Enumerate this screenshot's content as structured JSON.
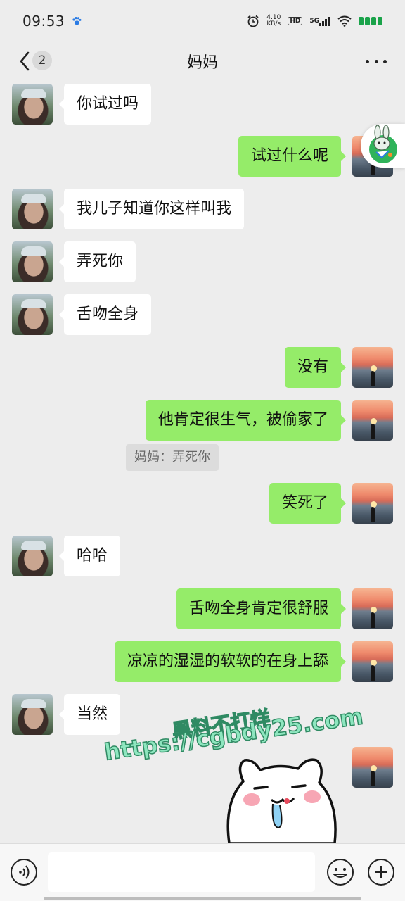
{
  "status_bar": {
    "time": "09:53",
    "net_speed_value": "4.10",
    "net_speed_unit": "KB/s",
    "hd_label": "HD",
    "signal_label": "5G",
    "battery_color": "#1aa34a"
  },
  "nav": {
    "unread_count": "2",
    "title": "妈妈"
  },
  "messages": [
    {
      "side": "in",
      "text": "你试过吗"
    },
    {
      "side": "out",
      "text": "试过什么呢"
    },
    {
      "side": "in",
      "text": "我儿子知道你这样叫我"
    },
    {
      "side": "in",
      "text": "弄死你"
    },
    {
      "side": "in",
      "text": "舌吻全身"
    },
    {
      "side": "out",
      "text": "没有"
    },
    {
      "side": "out",
      "text": "他肯定很生气，被偷家了"
    },
    {
      "side": "out",
      "text": "笑死了"
    },
    {
      "side": "in",
      "text": "哈哈"
    },
    {
      "side": "out",
      "text": "舌吻全身肯定很舒服"
    },
    {
      "side": "out",
      "text": "凉凉的湿湿的软软的在身上舔"
    },
    {
      "side": "in",
      "text": "当然"
    }
  ],
  "quote": {
    "text": "妈妈：弄死你"
  },
  "watermark": {
    "line1": "黑料不打烊",
    "line2": "https://cgbdy25.com"
  },
  "input": {
    "value": "",
    "placeholder": ""
  },
  "colors": {
    "background": "#ededed",
    "outgoing_bubble": "#95ec69",
    "incoming_bubble": "#ffffff",
    "quote_bg": "#dcdcdc"
  },
  "icons": {
    "back": "chevron-left-icon",
    "more": "more-dots-icon",
    "voice": "voice-icon",
    "emoji": "emoji-icon",
    "plus": "plus-icon"
  }
}
